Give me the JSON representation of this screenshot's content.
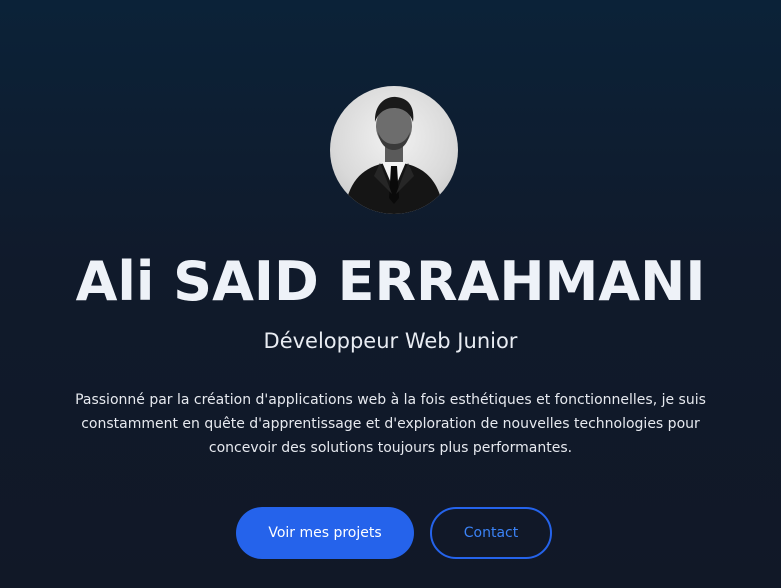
{
  "hero": {
    "avatar_icon": "profile-photo",
    "name": "Ali SAID ERRAHMANI",
    "role": "Développeur Web Junior",
    "bio": "Passionné par la création d'applications web à la fois esthétiques et fonctionnelles, je suis constamment en quête d'apprentissage et d'exploration de nouvelles technologies pour concevoir des solutions toujours plus performantes."
  },
  "actions": {
    "projects_label": "Voir mes projets",
    "contact_label": "Contact"
  },
  "colors": {
    "accent": "#2563eb",
    "accent_text": "#3b82f6",
    "background_top": "#0b2238",
    "background_bottom": "#111827"
  }
}
